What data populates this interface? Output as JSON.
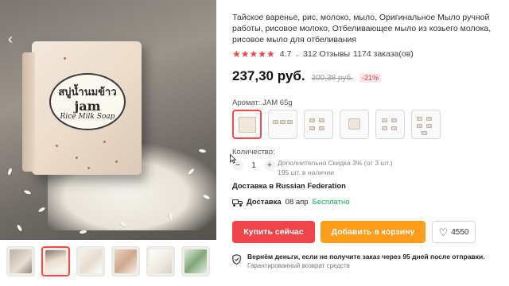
{
  "gallery": {
    "main_image": {
      "soap_label_thai": "สบู่น้ำนมข้าว",
      "soap_label_brand": "jam",
      "soap_label_sub": "Rice Milk Soap"
    },
    "prev_arrow_icon": "chevron-left-icon",
    "thumbnail_count": 6,
    "active_thumbnail": 2
  },
  "product": {
    "title": "Тайское варенье, рис, молоко, мыло, Оригинальное Мыло ручной работы, рисовое молоко, Отбеливающее мыло из козьего молока, рисовое мыло для отбеливания",
    "rating": "4.7",
    "rating_stars_fraction": 0.94,
    "reviews": "312 Отзывы",
    "orders": "1174 заказа(ов)",
    "price": "237,30 руб.",
    "old_price": "300,38 руб.",
    "discount": "-21%"
  },
  "options": {
    "aroma_label": "Аромат: JAM 65g",
    "variant_count": 6,
    "selected_variant": 1
  },
  "quantity": {
    "label": "Количество:",
    "minus": "−",
    "plus": "+",
    "value": "1",
    "extra_discount": "Дополнительно Скидка 3% (от 3 шт.)",
    "stock": "195 шт. в наличии"
  },
  "delivery": {
    "destination": "Доставка в Russian Federation",
    "label": "Доставка",
    "date": "08 апр",
    "cost": "Бесплатно"
  },
  "actions": {
    "buy_now": "Купить сейчас",
    "add_to_cart": "Добавить в корзину",
    "wishlist_count": "4550"
  },
  "guarantee": {
    "main": "Вернём деньги, если не получите заказ через 95 дней после отправки.",
    "sub": "Гарантированный возврат средств"
  },
  "colors": {
    "accent_red": "#f0434a",
    "accent_orange": "#ff9c1a",
    "free_green": "#19a05a"
  }
}
